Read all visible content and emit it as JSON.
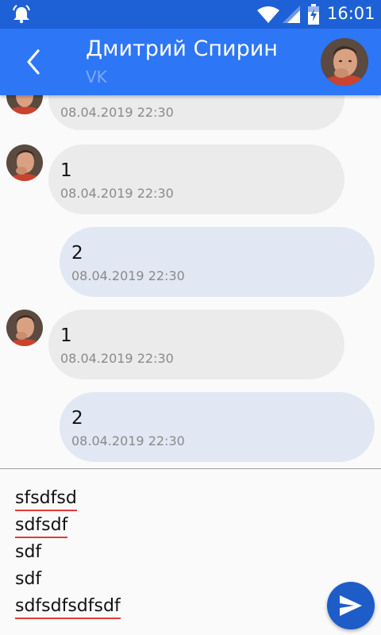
{
  "status_bar": {
    "time": "16:01",
    "icons": [
      "alarm-bell-icon",
      "wifi-icon",
      "cell-signal-icon",
      "battery-charging-icon"
    ]
  },
  "header": {
    "title": "Дмитрий Спирин",
    "subtitle": "VK",
    "back_icon": "chevron-left-icon",
    "avatar": "contact-avatar"
  },
  "messages": [
    {
      "direction": "incoming",
      "text": "",
      "date": "08.04.2019 22:30"
    },
    {
      "direction": "incoming",
      "text": "1",
      "date": "08.04.2019 22:30"
    },
    {
      "direction": "outgoing",
      "text": "2",
      "date": "08.04.2019 22:30"
    },
    {
      "direction": "incoming",
      "text": "1",
      "date": "08.04.2019 22:30"
    },
    {
      "direction": "outgoing",
      "text": "2",
      "date": "08.04.2019 22:30"
    }
  ],
  "composer": {
    "lines": [
      {
        "text": "sfsdfsd",
        "spelling_error": true
      },
      {
        "text": "sdfsdf",
        "spelling_error": true
      },
      {
        "text": "sdf",
        "spelling_error": false
      },
      {
        "text": "sdf",
        "spelling_error": false
      },
      {
        "text": "sdfsdfsdfsdf",
        "spelling_error": true
      }
    ],
    "send_icon": "send-icon"
  },
  "colors": {
    "status_bar": "#1e61d6",
    "app_bar": "#2d76f6",
    "incoming_bubble": "#ebebeb",
    "outgoing_bubble": "#e1e7f3",
    "send_button": "#1e5cc8",
    "spell_error_underline": "#e53935"
  }
}
